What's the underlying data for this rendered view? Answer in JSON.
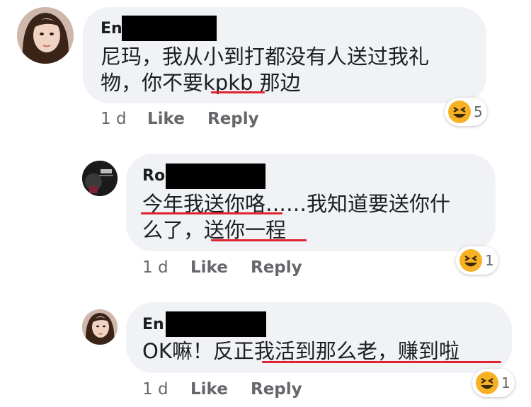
{
  "comments": [
    {
      "author_visible": "En",
      "text_lines": [
        "尼玛，我从小到打都没有人送过我礼",
        "物，你不要kpkb 那边"
      ],
      "time": "1 d",
      "like_label": "Like",
      "reply_label": "Reply",
      "reaction_icon": "laughing-emoji-icon",
      "reaction_count": "5"
    },
    {
      "author_visible": "Ro",
      "text_lines": [
        "今年我送你咯……我知道要送你什",
        "么了，送你一程"
      ],
      "time": "1 d",
      "like_label": "Like",
      "reply_label": "Reply",
      "reaction_icon": "laughing-emoji-icon",
      "reaction_count": "1"
    },
    {
      "author_visible": "En",
      "text_lines": [
        "OK嘛！反正我活到那么老，赚到啦"
      ],
      "time": "1 d",
      "like_label": "Like",
      "reply_label": "Reply",
      "reaction_icon": "laughing-emoji-icon",
      "reaction_count": "1"
    }
  ],
  "colors": {
    "bubble": "#f0f2f5",
    "underline": "#e0232f",
    "meta": "#65676b",
    "emoji": "#f7b125"
  }
}
